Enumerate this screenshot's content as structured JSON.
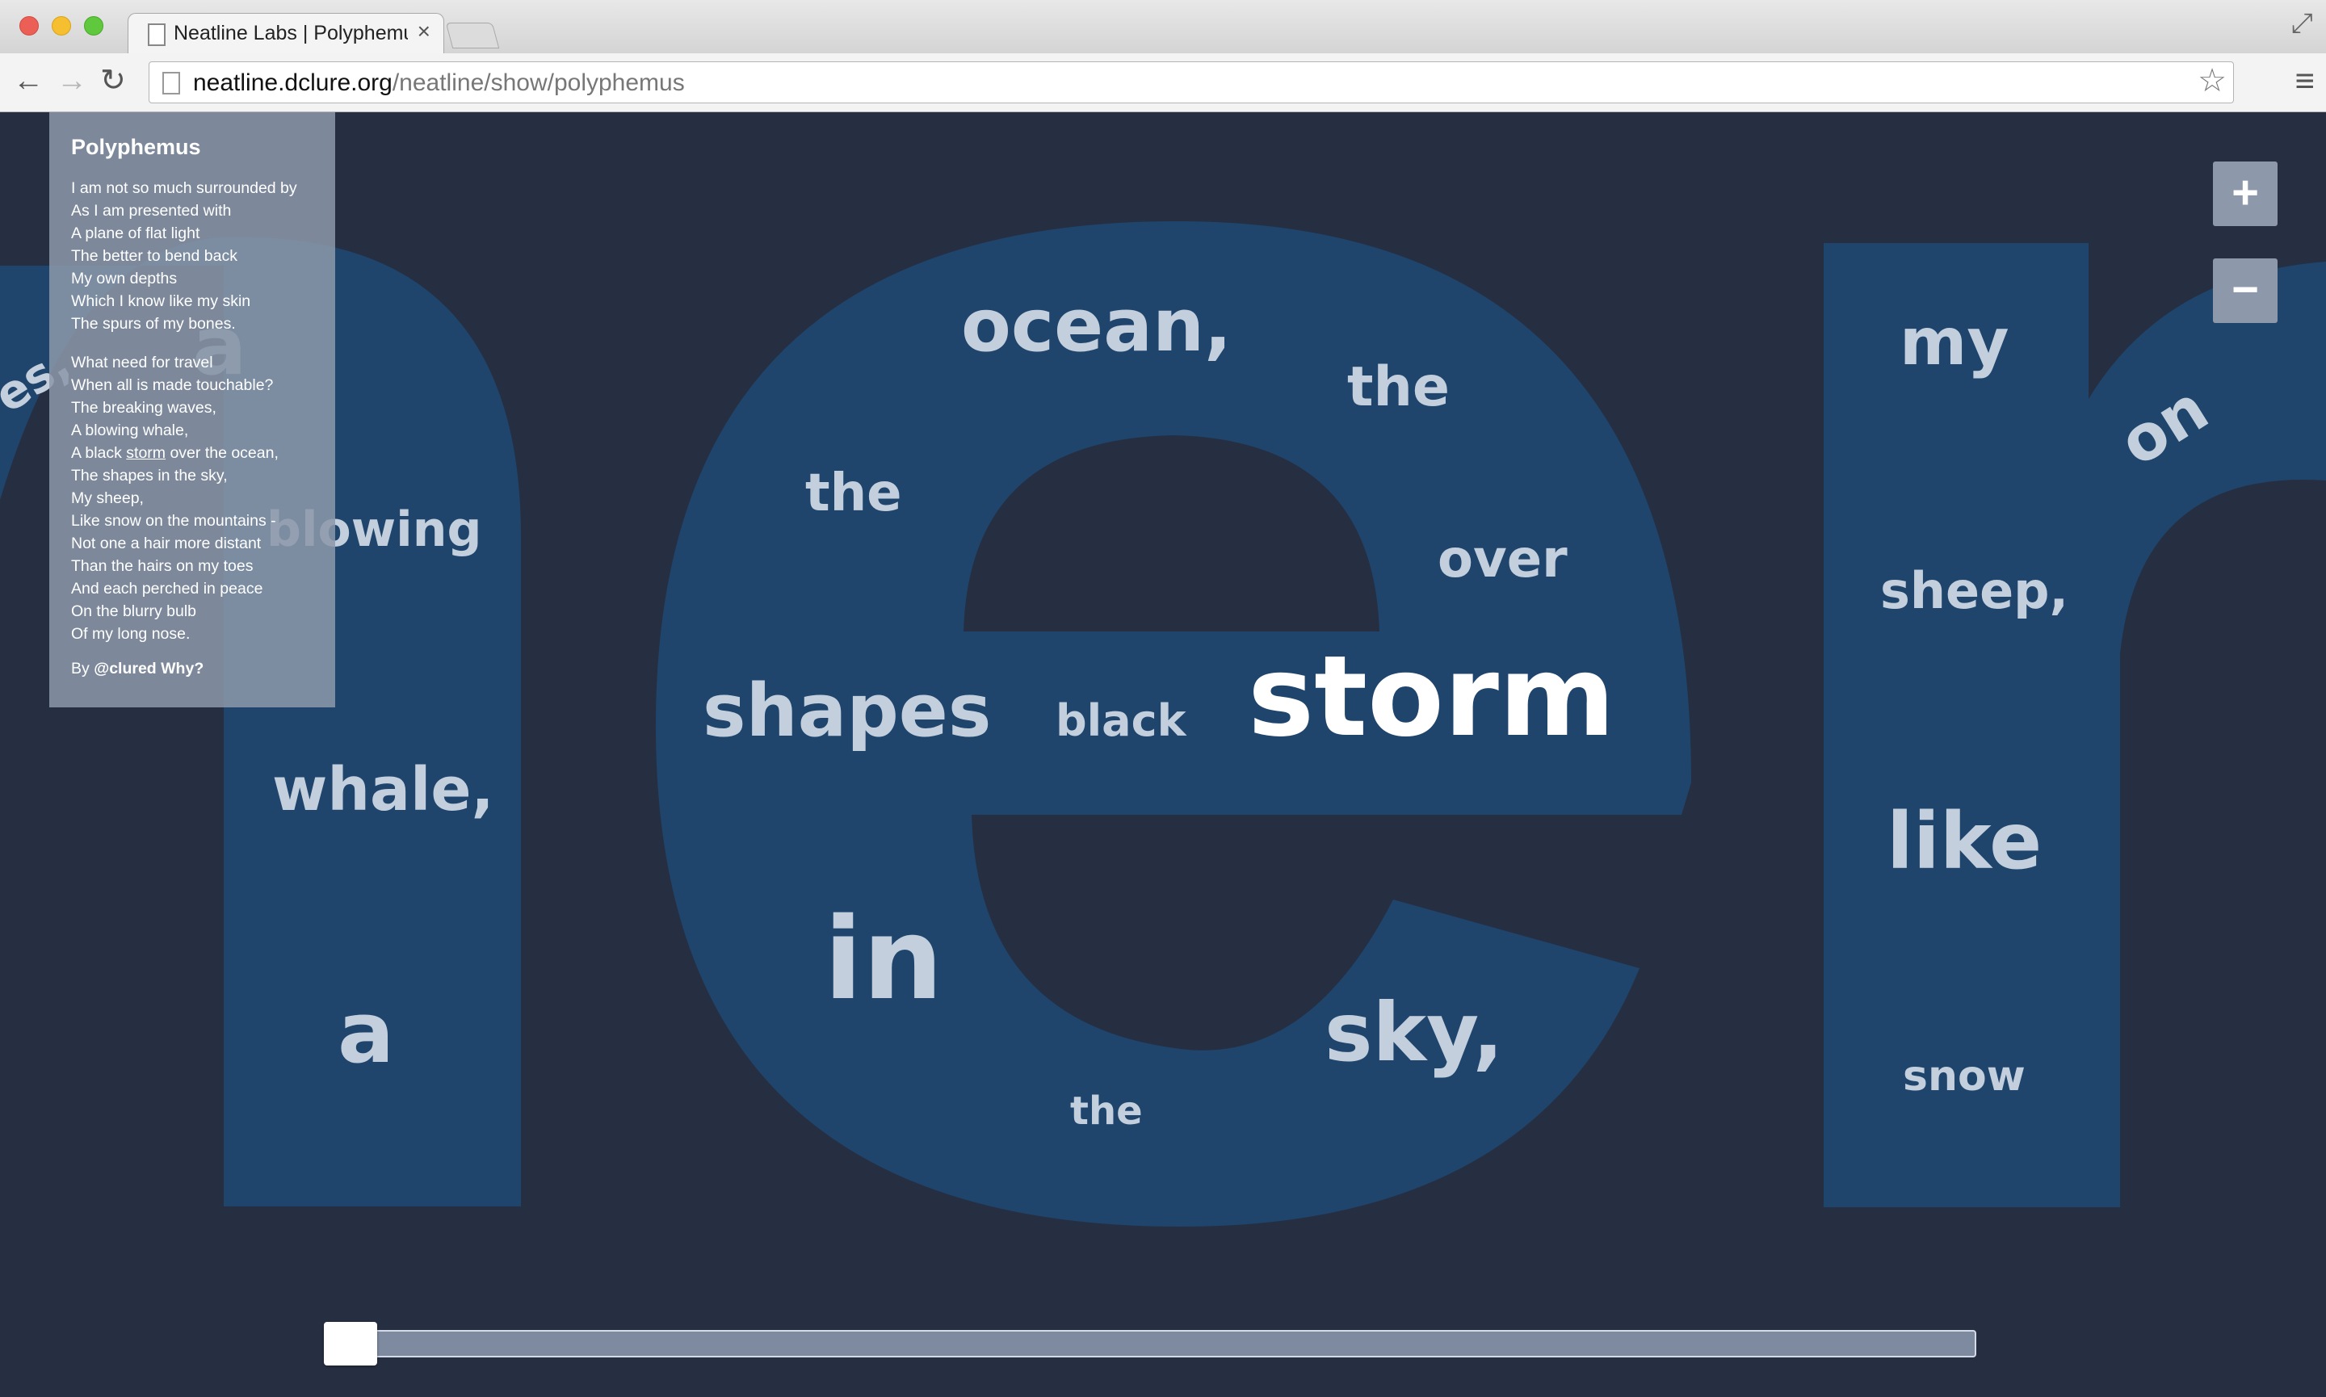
{
  "browser": {
    "tab_title": "Neatline Labs | Polyphemus",
    "tab_close": "×",
    "back_label": "←",
    "forward_label": "→",
    "reload_label": "↻",
    "url_host": "neatline.dclure.org",
    "url_path": "/neatline/show/polyphemus",
    "star_label": "☆",
    "menu_label": "≡",
    "fullscreen_label": "⤢"
  },
  "colors": {
    "map_background": "#262f42",
    "letter_fill": "#1f456d",
    "word": "#c3cfdd",
    "word_highlight": "#ffffff",
    "panel": "#8c98aa"
  },
  "poem": {
    "title": "Polyphemus",
    "stanza1": [
      "I am not so much surrounded by",
      "As I am presented with",
      "A plane of flat light",
      "The better to bend back",
      "My own depths",
      "Which I know like my skin",
      "The spurs of my bones."
    ],
    "stanza2_before_highlight": [
      "What need for travel",
      "When all is made touchable?",
      "The breaking waves,",
      "A blowing whale,"
    ],
    "highlight_line": {
      "before": "A black ",
      "highlight": "storm",
      "after": " over the ocean,"
    },
    "stanza2_after_highlight": [
      "The shapes in the sky,",
      "My sheep,",
      "Like snow on the mountains -",
      "Not one a hair more distant",
      "Than the hairs on my toes",
      "And each perched in peace",
      "On the blurry bulb",
      "Of my long nose."
    ],
    "byline_prefix": "By ",
    "byline_author": "@clured",
    "byline_why": "Why?"
  },
  "map_words": [
    "es,",
    "a",
    "blowing",
    "whale,",
    "a",
    "ocean,",
    "the",
    "the",
    "over",
    "shapes",
    "black",
    "storm",
    "in",
    "sky,",
    "the",
    "my",
    "on",
    "sheep,",
    "like",
    "snow"
  ],
  "zoom": {
    "in_label": "+",
    "out_label": "−"
  },
  "timeline": {
    "position_fraction": 0.0
  }
}
